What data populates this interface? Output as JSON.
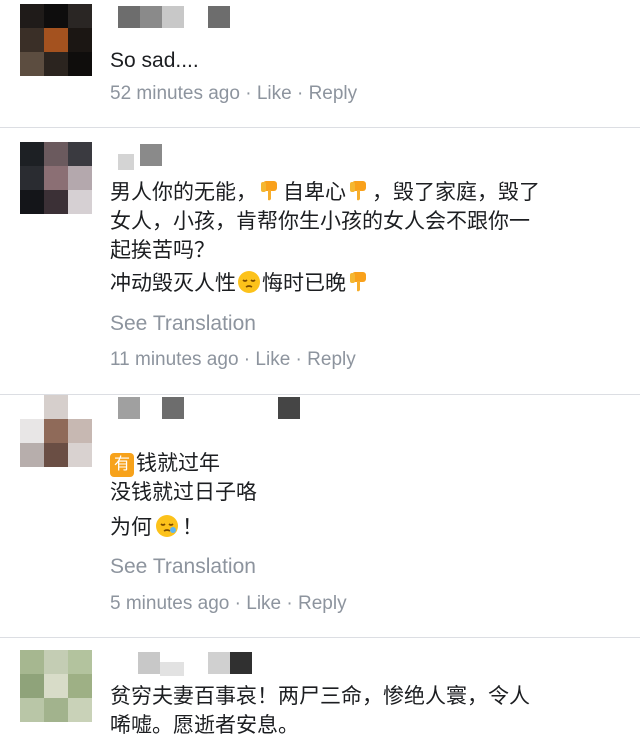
{
  "comments": [
    {
      "lines": [
        "So sad...."
      ],
      "meta": {
        "time": "52 minutes ago",
        "sep1": " · ",
        "like": "Like",
        "sep2": " · ",
        "reply": "Reply"
      }
    },
    {
      "line1_a": "男人你的无能，",
      "line1_b": "自卑心",
      "line1_c": "，毁了家庭，毁了",
      "line2": "女人，小孩，肯帮你生小孩的女人会不跟你一",
      "line3": "起挨苦吗？",
      "line4_a": "冲动毁灭人性",
      "line4_b": "悔时已晚",
      "see_translation": "See Translation",
      "meta": {
        "time": "11 minutes ago",
        "sep1": " · ",
        "like": "Like",
        "sep2": " · ",
        "reply": "Reply"
      }
    },
    {
      "badge": "有",
      "line1": "钱就过年",
      "line2": "没钱就过日子咯",
      "line3_a": "为何",
      "line3_b": "！",
      "see_translation": "See Translation",
      "meta": {
        "time": "5 minutes ago",
        "sep1": " · ",
        "like": "Like",
        "sep2": " · ",
        "reply": "Reply"
      }
    },
    {
      "line1": "贫穷夫妻百事哀！两尸三命，惨绝人寰，令人",
      "line2": "唏嘘。愿逝者安息。"
    }
  ],
  "icons": {
    "thumbs_down": "thumbs-down-emoji",
    "pensive": "pensive-face-emoji",
    "sleepy": "sleepy-face-emoji"
  },
  "colors": {
    "meta_gray": "#8d949e",
    "separator": "#dcdee3",
    "emoji_yellow": "#fcc21b"
  }
}
